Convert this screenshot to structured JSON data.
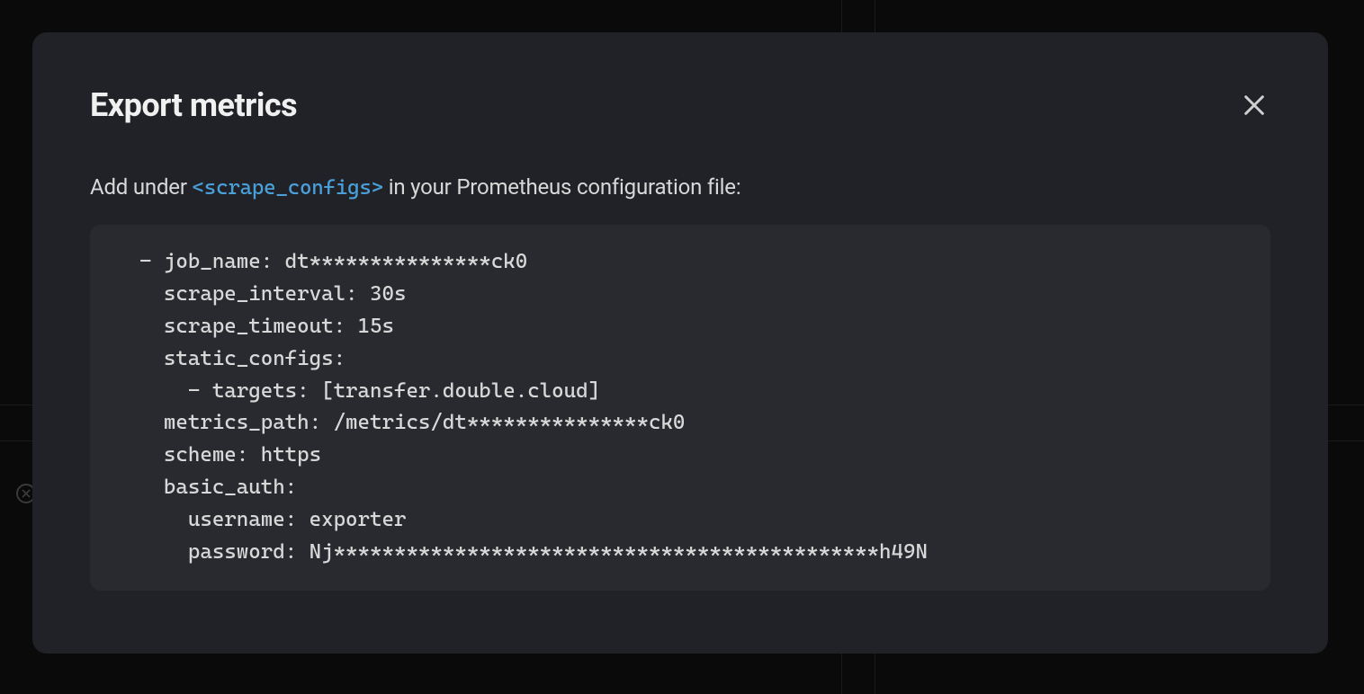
{
  "modal": {
    "title": "Export metrics",
    "instruction_prefix": "Add under ",
    "instruction_link": "<scrape_configs>",
    "instruction_suffix": " in your Prometheus configuration file:",
    "code": "  - job_name: dt***************ck0\n    scrape_interval: 30s\n    scrape_timeout: 15s\n    static_configs:\n      - targets: [transfer.double.cloud]\n    metrics_path: /metrics/dt***************ck0\n    scheme: https\n    basic_auth:\n      username: exporter\n      password: Nj*********************************************h49N"
  }
}
